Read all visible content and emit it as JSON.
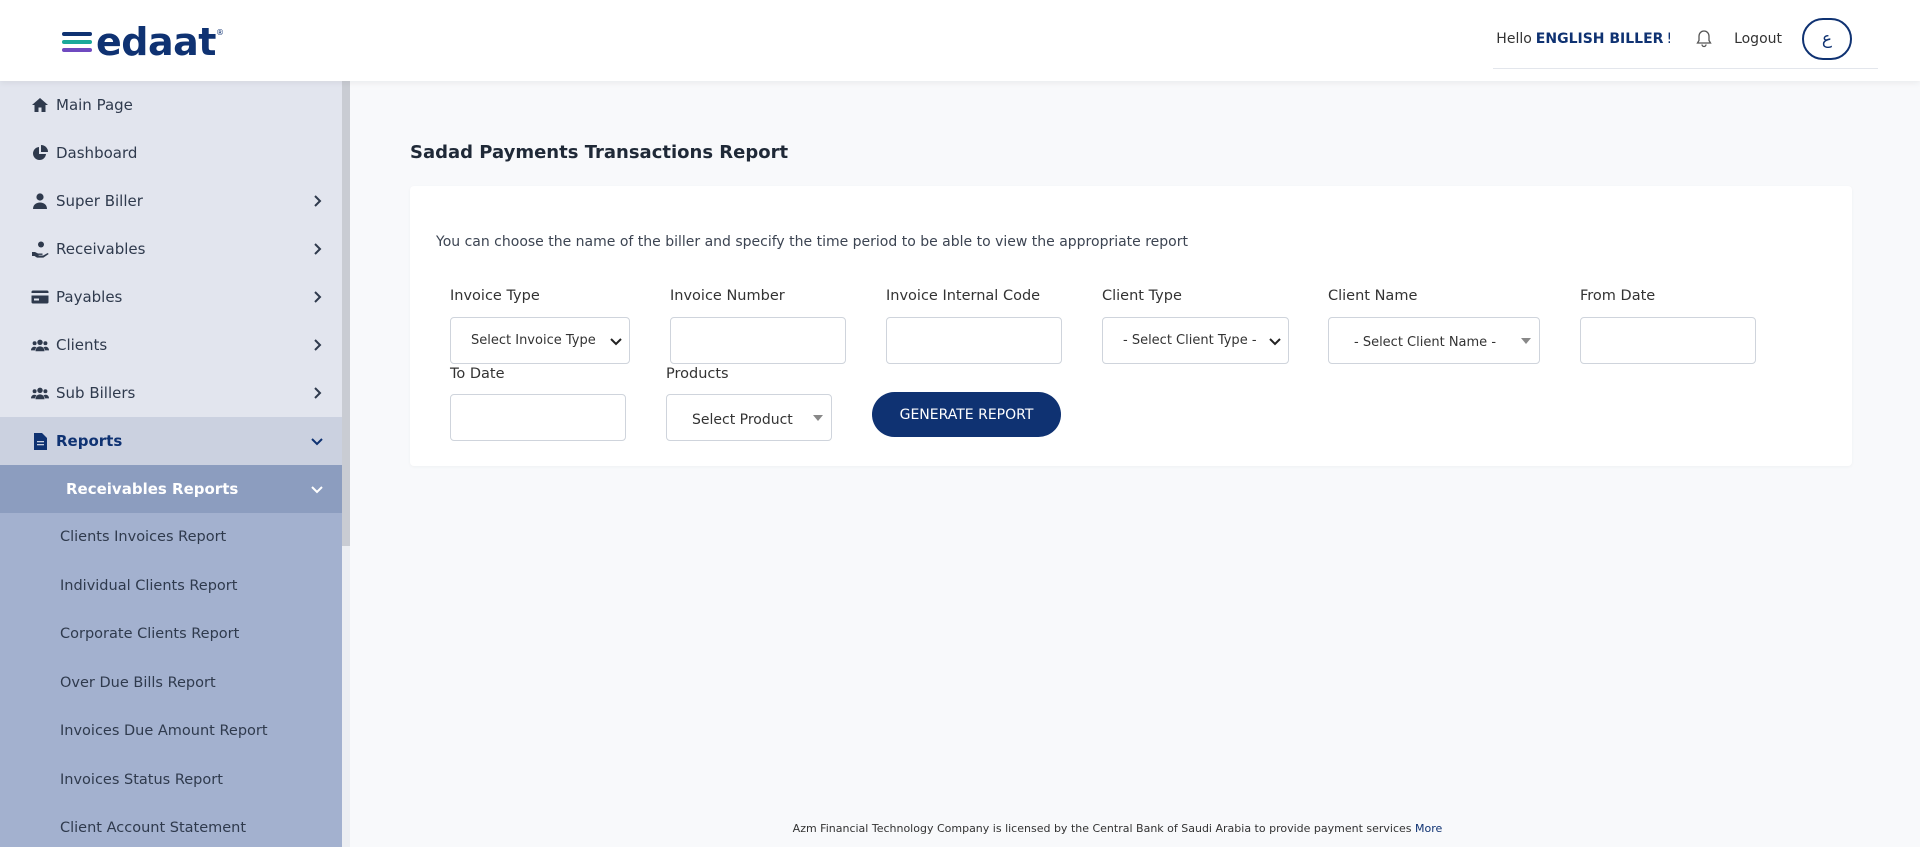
{
  "header": {
    "logo_text": "edaat",
    "logo_reg": "®",
    "greeting": "Hello",
    "user_name": "ENGLISH BILLER",
    "greeting_suffix": "!",
    "logout_label": "Logout",
    "language_toggle": "ع",
    "colors": {
      "brand": "#0f3272",
      "logo_bar_1": "#0f3272",
      "logo_bar_2": "#1aa89a",
      "logo_bar_3": "#6f4ac0"
    }
  },
  "sidebar": {
    "items": [
      {
        "label": "Main Page",
        "icon": "home-icon"
      },
      {
        "label": "Dashboard",
        "icon": "pie-chart-icon"
      },
      {
        "label": "Super Biller",
        "icon": "user-icon"
      },
      {
        "label": "Receivables",
        "icon": "hand-money-icon"
      },
      {
        "label": "Payables",
        "icon": "credit-card-icon"
      },
      {
        "label": "Clients",
        "icon": "users-icon"
      },
      {
        "label": "Sub Billers",
        "icon": "users-group-icon"
      },
      {
        "label": "Reports",
        "icon": "document-icon"
      }
    ],
    "sub_section": "Receivables Reports",
    "reports": [
      "Clients Invoices Report",
      "Individual Clients Report",
      "Corporate Clients Report",
      "Over Due Bills Report",
      "Invoices Due Amount Report",
      "Invoices Status Report",
      "Client Account Statement"
    ]
  },
  "main": {
    "title": "Sadad Payments Transactions Report",
    "intro": "You can choose the name of the biller and specify the time period to be able to view the appropriate report",
    "fields": {
      "invoice_type": {
        "label": "Invoice Type",
        "value": "Select Invoice Type"
      },
      "invoice_number": {
        "label": "Invoice Number",
        "value": ""
      },
      "invoice_internal_code": {
        "label": "Invoice Internal Code",
        "value": ""
      },
      "client_type": {
        "label": "Client Type",
        "value": "- Select Client Type -"
      },
      "client_name": {
        "label": "Client Name",
        "value": "- Select Client Name -"
      },
      "from_date": {
        "label": "From Date",
        "value": ""
      },
      "to_date": {
        "label": "To Date",
        "value": ""
      },
      "products": {
        "label": "Products",
        "value": "Select Product"
      }
    },
    "generate_button": "GENERATE REPORT"
  },
  "footer": {
    "text": "Azm Financial Technology Company is licensed by the Central Bank of Saudi Arabia to provide payment services",
    "more_link": "More"
  }
}
